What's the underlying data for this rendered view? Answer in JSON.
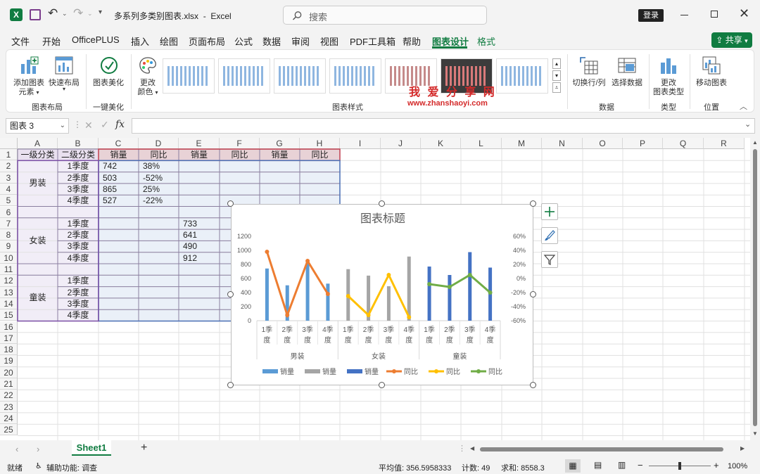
{
  "titlebar": {
    "filename": "多系列多类别图表.xlsx",
    "sep": "-",
    "app": "Excel",
    "search_placeholder": "搜索",
    "login": "登录"
  },
  "tabs": [
    "文件",
    "开始",
    "OfficePLUS",
    "插入",
    "绘图",
    "页面布局",
    "公式",
    "数据",
    "审阅",
    "视图",
    "PDF工具箱",
    "帮助",
    "图表设计",
    "格式"
  ],
  "active_tab": "图表设计",
  "share_label": "共享",
  "ribbon": {
    "add_element": [
      "添加图表",
      "元素"
    ],
    "quick_layout": [
      "快速布局"
    ],
    "group_layout": "图表布局",
    "beautify": "图表美化",
    "group_beautify": "一键美化",
    "change_color": [
      "更改",
      "颜色"
    ],
    "group_styles": "图表样式",
    "watermark": "我 爱 分 享 网",
    "watermark_url": "www.zhanshaoyi.com",
    "switch_rowcol": "切换行/列",
    "select_data": "选择数据",
    "group_data": "数据",
    "change_type": [
      "更改",
      "图表类型"
    ],
    "group_type": "类型",
    "move_chart": "移动图表",
    "group_location": "位置"
  },
  "formula": {
    "name_box": "图表 3",
    "fx": "fx",
    "content": ""
  },
  "columns": [
    "A",
    "B",
    "C",
    "D",
    "E",
    "F",
    "G",
    "H",
    "I",
    "J",
    "K",
    "L",
    "M",
    "N",
    "O",
    "P",
    "Q",
    "R"
  ],
  "rows": [
    "1",
    "2",
    "3",
    "4",
    "5",
    "6",
    "7",
    "8",
    "9",
    "10",
    "11",
    "12",
    "13",
    "14",
    "15",
    "16",
    "17",
    "18",
    "19",
    "20",
    "21",
    "22",
    "23",
    "24",
    "25"
  ],
  "table": {
    "headers": [
      "一级分类",
      "二级分类",
      "销量",
      "同比",
      "销量",
      "同比",
      "销量",
      "同比"
    ],
    "groups": [
      "男装",
      "女装",
      "童装"
    ],
    "quarters": [
      "1季度",
      "2季度",
      "3季度",
      "4季度"
    ],
    "men_sales": [
      "742",
      "503",
      "865",
      "527"
    ],
    "men_yoy": [
      "38%",
      "-52%",
      "25%",
      "-22%"
    ],
    "women_sales": [
      "733",
      "641",
      "490",
      "912"
    ]
  },
  "chart_data": {
    "type": "bar",
    "title": "图表标题",
    "groups": [
      "男装",
      "女装",
      "童装"
    ],
    "categories": [
      "1季度",
      "2季度",
      "3季度",
      "4季度"
    ],
    "y_left": {
      "min": 0,
      "max": 1200,
      "ticks": [
        "0",
        "200",
        "400",
        "600",
        "800",
        "1000",
        "1200"
      ]
    },
    "y_right": {
      "min": -60,
      "max": 60,
      "ticks": [
        "-60%",
        "-40%",
        "-20%",
        "0%",
        "20%",
        "40%",
        "60%"
      ]
    },
    "series": [
      {
        "name": "销量",
        "group": "男装",
        "kind": "bar",
        "color": "#5b9bd5",
        "values": [
          742,
          503,
          865,
          527
        ]
      },
      {
        "name": "销量",
        "group": "女装",
        "kind": "bar",
        "color": "#a5a5a5",
        "values": [
          733,
          641,
          490,
          912
        ]
      },
      {
        "name": "销量",
        "group": "童装",
        "kind": "bar",
        "color": "#4472c4",
        "values": [
          770,
          650,
          975,
          755
        ]
      },
      {
        "name": "同比",
        "group": "男装",
        "kind": "line",
        "color": "#ed7d31",
        "values": [
          38,
          -52,
          25,
          -22
        ]
      },
      {
        "name": "同比",
        "group": "女装",
        "kind": "line",
        "color": "#ffc000",
        "values": [
          -25,
          -52,
          5,
          -55
        ]
      },
      {
        "name": "同比",
        "group": "童装",
        "kind": "line",
        "color": "#70ad47",
        "values": [
          -8,
          -12,
          5,
          -20
        ]
      }
    ],
    "legend": [
      "销量",
      "销量",
      "销量",
      "同比",
      "同比",
      "同比"
    ],
    "legend_position": "bottom"
  },
  "sheet": {
    "tab": "Sheet1",
    "add": "+"
  },
  "status": {
    "ready": "就绪",
    "accessibility": "辅助功能: 调查",
    "average": "平均值: 356.5958333",
    "count": "计数: 49",
    "sum": "求和: 8558.3",
    "zoom": "100%"
  }
}
